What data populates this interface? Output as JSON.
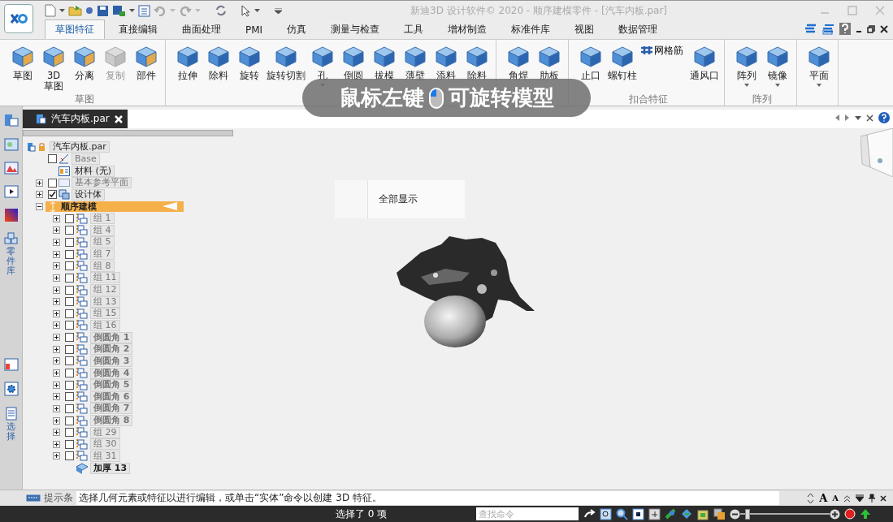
{
  "window": {
    "title": "新迪3D 设计软件© 2020 - 顺序建模零件 - [汽车内板.par]"
  },
  "quick_access": {
    "undo_disabled": true,
    "redo_disabled": true
  },
  "tabs": [
    {
      "label": "草图特征",
      "selected": true
    },
    {
      "label": "直接编辑",
      "selected": false
    },
    {
      "label": "曲面处理",
      "selected": false
    },
    {
      "label": "PMI",
      "selected": false
    },
    {
      "label": "仿真",
      "selected": false
    },
    {
      "label": "测量与检查",
      "selected": false
    },
    {
      "label": "工具",
      "selected": false
    },
    {
      "label": "增材制造",
      "selected": false
    },
    {
      "label": "标准件库",
      "selected": false
    },
    {
      "label": "视图",
      "selected": false
    },
    {
      "label": "数据管理",
      "selected": false
    }
  ],
  "ribbon": {
    "groups": [
      {
        "label": "草图",
        "buttons": [
          {
            "label": "草图",
            "kind": "large",
            "disabled": false,
            "dropdown": false
          },
          {
            "label": "3D\n草图",
            "kind": "large",
            "disabled": false,
            "dropdown": false
          },
          {
            "label": "分离",
            "kind": "large",
            "disabled": false,
            "dropdown": false
          },
          {
            "label": "复制",
            "kind": "large",
            "disabled": true,
            "dropdown": false
          },
          {
            "label": "部件",
            "kind": "large",
            "disabled": false,
            "dropdown": false
          }
        ]
      },
      {
        "buttons": [
          {
            "label": "拉伸",
            "kind": "large",
            "disabled": false,
            "dropdown": false
          },
          {
            "label": "除料",
            "kind": "large",
            "disabled": false,
            "dropdown": false
          },
          {
            "label": "旋转",
            "kind": "large",
            "disabled": false,
            "dropdown": false
          },
          {
            "label": "旋转切割",
            "kind": "large",
            "disabled": false,
            "dropdown": false
          },
          {
            "label": "孔",
            "kind": "large",
            "disabled": false,
            "dropdown": true
          },
          {
            "label": "倒圆",
            "kind": "large",
            "disabled": false,
            "dropdown": false
          },
          {
            "label": "拔模",
            "kind": "large",
            "disabled": false,
            "dropdown": false
          },
          {
            "label": "薄壁",
            "kind": "large",
            "disabled": false,
            "dropdown": false
          },
          {
            "label": "添料",
            "kind": "large",
            "disabled": false,
            "dropdown": false
          },
          {
            "label": "除料",
            "kind": "large",
            "disabled": false,
            "dropdown": false
          }
        ]
      },
      {
        "buttons": [
          {
            "label": "角焊",
            "kind": "large",
            "disabled": false,
            "dropdown": false
          },
          {
            "label": "肋板",
            "kind": "large",
            "disabled": false,
            "dropdown": false
          }
        ]
      },
      {
        "label": "扣合特征",
        "buttons": [
          {
            "label": "止口",
            "kind": "large",
            "disabled": false,
            "dropdown": false
          },
          {
            "label": "螺钉柱",
            "kind": "large",
            "disabled": false,
            "dropdown": false
          },
          {
            "label": "网格筋",
            "kind": "small",
            "disabled": false,
            "dropdown": false
          },
          {
            "label": "通风口",
            "kind": "large",
            "disabled": false,
            "dropdown": false
          }
        ]
      },
      {
        "label": "阵列",
        "buttons": [
          {
            "label": "阵列",
            "kind": "large",
            "disabled": false,
            "dropdown": true
          },
          {
            "label": "镜像",
            "kind": "large",
            "disabled": false,
            "dropdown": true
          }
        ]
      },
      {
        "buttons": [
          {
            "label": "平面",
            "kind": "large",
            "disabled": false,
            "dropdown": true
          }
        ]
      }
    ]
  },
  "overlay_hint": {
    "before": "鼠标左键",
    "after": "可旋转模型"
  },
  "side_panel": {
    "tabs": [
      {
        "label": "零件库"
      },
      {
        "label": "选择"
      }
    ]
  },
  "document_tab": {
    "label": "汽车内板.par"
  },
  "tree": {
    "items": [
      {
        "label": "汽车内板.par",
        "kind": "part",
        "selected": false,
        "disabled": false,
        "children": [
          {
            "label": "Base",
            "kind": "sketch",
            "checked": false,
            "selected": false,
            "disabled": true
          },
          {
            "label": "材料 (无)",
            "kind": "material",
            "selected": false,
            "disabled": false
          },
          {
            "label": "基本参考平面",
            "kind": "plane",
            "checked": false,
            "expanded": false,
            "selected": false,
            "disabled": true
          },
          {
            "label": "设计体",
            "kind": "body",
            "checked": true,
            "expanded": false,
            "selected": false,
            "disabled": false
          },
          {
            "label": "顺序建模",
            "kind": "sequence",
            "expanded": true,
            "selected": true,
            "disabled": false,
            "children": [
              {
                "label": "组 1",
                "kind": "group",
                "checked": false,
                "expanded": false,
                "selected": false,
                "disabled": true
              },
              {
                "label": "组 4",
                "kind": "group",
                "checked": false,
                "expanded": false,
                "selected": false,
                "disabled": true
              },
              {
                "label": "组 5",
                "kind": "group",
                "checked": false,
                "expanded": false,
                "selected": false,
                "disabled": true
              },
              {
                "label": "组 7",
                "kind": "group",
                "checked": false,
                "expanded": false,
                "selected": false,
                "disabled": true
              },
              {
                "label": "组 8",
                "kind": "group",
                "checked": false,
                "expanded": false,
                "selected": false,
                "disabled": true
              },
              {
                "label": "组 11",
                "kind": "group",
                "checked": false,
                "expanded": false,
                "selected": false,
                "disabled": true
              },
              {
                "label": "组 12",
                "kind": "group",
                "checked": false,
                "expanded": false,
                "selected": false,
                "disabled": true
              },
              {
                "label": "组 13",
                "kind": "group",
                "checked": false,
                "expanded": false,
                "selected": false,
                "disabled": true
              },
              {
                "label": "组 15",
                "kind": "group",
                "checked": false,
                "expanded": false,
                "selected": false,
                "disabled": true
              },
              {
                "label": "组 16",
                "kind": "group",
                "checked": false,
                "expanded": false,
                "selected": false,
                "disabled": true
              },
              {
                "label": "倒圆角 1",
                "kind": "fillet",
                "checked": false,
                "expanded": false,
                "selected": false,
                "disabled": true
              },
              {
                "label": "倒圆角 2",
                "kind": "fillet",
                "checked": false,
                "expanded": false,
                "selected": false,
                "disabled": true
              },
              {
                "label": "倒圆角 3",
                "kind": "fillet",
                "checked": false,
                "expanded": false,
                "selected": false,
                "disabled": true
              },
              {
                "label": "倒圆角 4",
                "kind": "fillet",
                "checked": false,
                "expanded": false,
                "selected": false,
                "disabled": true
              },
              {
                "label": "倒圆角 5",
                "kind": "fillet",
                "checked": false,
                "expanded": false,
                "selected": false,
                "disabled": true
              },
              {
                "label": "倒圆角 6",
                "kind": "fillet",
                "checked": false,
                "expanded": false,
                "selected": false,
                "disabled": true
              },
              {
                "label": "倒圆角 7",
                "kind": "fillet",
                "checked": false,
                "expanded": false,
                "selected": false,
                "disabled": true
              },
              {
                "label": "倒圆角 8",
                "kind": "fillet",
                "checked": false,
                "expanded": false,
                "selected": false,
                "disabled": true
              },
              {
                "label": "组 29",
                "kind": "group",
                "checked": false,
                "expanded": false,
                "selected": false,
                "disabled": true
              },
              {
                "label": "组 30",
                "kind": "group",
                "checked": false,
                "expanded": false,
                "selected": false,
                "disabled": true
              },
              {
                "label": "组 31",
                "kind": "group",
                "checked": false,
                "expanded": false,
                "selected": false,
                "disabled": true
              },
              {
                "label": "加厚 13",
                "kind": "thicken",
                "selected": false,
                "disabled": false
              }
            ]
          }
        ]
      }
    ]
  },
  "context_menu": {
    "items": [
      "全部显示"
    ]
  },
  "hint_bar": {
    "label": "提示条",
    "message": "选择几何元素或特征以进行编辑，或单击“实体”命令以创建 3D 特征。",
    "font_buttons": [
      "A",
      "A"
    ]
  },
  "status_bar": {
    "selection": "选择了 0 项",
    "search_placeholder": "查找命令",
    "zoom": {
      "level": 0.08
    }
  }
}
